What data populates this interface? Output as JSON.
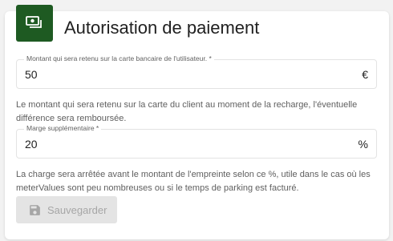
{
  "panel": {
    "title": "Autorisation de paiement",
    "accent_color": "#1e5a22",
    "header_icon": "payments-icon"
  },
  "amount_field": {
    "label": "Montant qui sera retenu sur la carte bancaire de l'utilisateur. *",
    "value": "50",
    "suffix": "€",
    "help": "Le montant qui sera retenu sur la carte du client au moment de la recharge, l'éventuelle différence sera remboursée."
  },
  "margin_field": {
    "label": "Marge supplémentaire *",
    "value": "20",
    "suffix": "%",
    "help": "La charge sera arrêtée avant le montant de l'empreinte selon ce %, utile dans le cas où les meterValues sont peu nombreuses ou si le temps de parking est facturé."
  },
  "save_button": {
    "label": "Sauvegarder",
    "icon": "save-icon",
    "disabled": true
  }
}
